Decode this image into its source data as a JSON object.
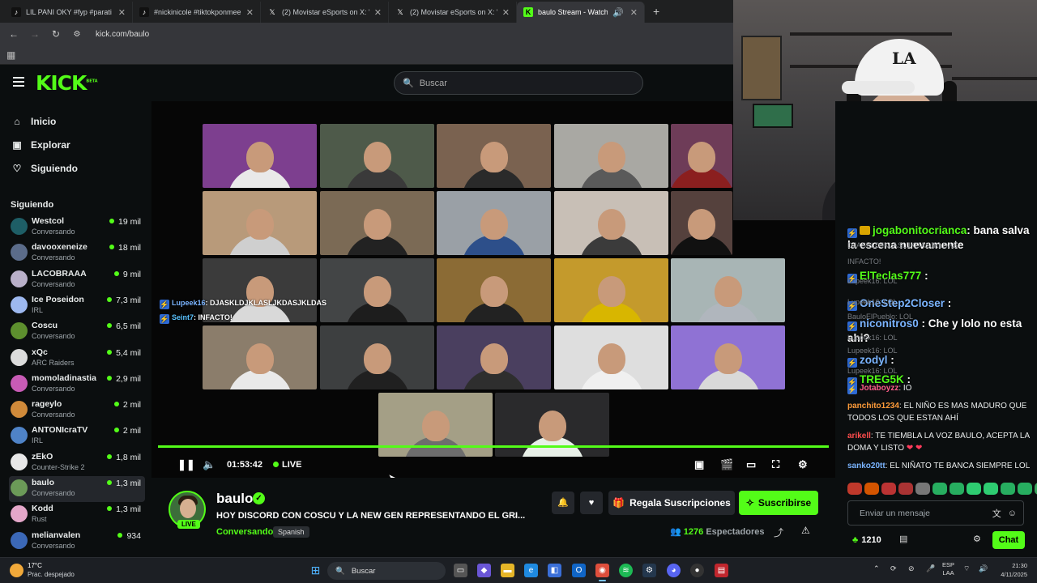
{
  "browser": {
    "tabs": [
      {
        "title": "LIL PANI OKY #fyp #parati #oky",
        "icon": "tiktok-icon",
        "active": false
      },
      {
        "title": "#nickinicole #tiktokponmee",
        "icon": "tiktok-icon",
        "active": false
      },
      {
        "title": "(2) Movistar eSports on X: \"",
        "icon": "x-icon",
        "active": false
      },
      {
        "title": "(2) Movistar eSports on X: \"",
        "icon": "x-icon",
        "active": false
      },
      {
        "title": "baulo Stream - Watch Live",
        "icon": "kick-icon",
        "active": true
      }
    ],
    "new_tab": "+",
    "url": "kick.com/baulo"
  },
  "kick": {
    "logo": "KICK",
    "logo_sup": "BETA",
    "search_placeholder": "Buscar",
    "nav": [
      {
        "label": "Inicio",
        "icon": "home-icon"
      },
      {
        "label": "Explorar",
        "icon": "compass-icon"
      },
      {
        "label": "Siguiendo",
        "icon": "heart-icon"
      }
    ],
    "following_title": "Siguiendo",
    "following": [
      {
        "name": "Westcol",
        "category": "Conversando",
        "viewers": "19 mil",
        "color": "#1e5e66"
      },
      {
        "name": "davooxeneize",
        "category": "Conversando",
        "viewers": "18 mil",
        "color": "#5b6c8a"
      },
      {
        "name": "LACOBRAAA",
        "category": "Conversando",
        "viewers": "9 mil",
        "color": "#b9b0c9"
      },
      {
        "name": "Ice Poseidon",
        "category": "IRL",
        "viewers": "7,3 mil",
        "color": "#9db8ef"
      },
      {
        "name": "Coscu",
        "category": "Conversando",
        "viewers": "6,5 mil",
        "color": "#5d8f2e"
      },
      {
        "name": "xQc",
        "category": "ARC Raiders",
        "viewers": "5,4 mil",
        "color": "#dcdcdc"
      },
      {
        "name": "momoladinastia",
        "category": "Conversando",
        "viewers": "2,9 mil",
        "color": "#c85bb5"
      },
      {
        "name": "rageylo",
        "category": "Conversando",
        "viewers": "2 mil",
        "color": "#d08a3a"
      },
      {
        "name": "ANTONIcraTV",
        "category": "IRL",
        "viewers": "2 mil",
        "color": "#4f83c7"
      },
      {
        "name": "zEkO",
        "category": "Counter-Strike 2",
        "viewers": "1,8 mil",
        "color": "#e7e7e7"
      },
      {
        "name": "baulo",
        "category": "Conversando",
        "viewers": "1,3 mil",
        "color": "#6b9a58"
      },
      {
        "name": "Kodd",
        "category": "Rust",
        "viewers": "1,3 mil",
        "color": "#e4a7c9"
      },
      {
        "name": "melianvalen",
        "category": "Conversando",
        "viewers": "934",
        "color": "#3b68b7"
      }
    ],
    "active_channel": "baulo"
  },
  "player": {
    "overlay_chat": [
      {
        "user": "Lupeek16",
        "text": ": DJASKLDJKLASLJKDASJKLDAS"
      },
      {
        "user": "Seint7",
        "text": ": INFACTO!"
      }
    ],
    "time": "01:53:42",
    "live_label": "LIVE",
    "progress": 1.0
  },
  "stream": {
    "streamer": "baulo",
    "live_badge": "LIVE",
    "title": "HOY DISCORD CON COSCU Y LA NEW GEN REPRESENTANDO EL GRI...",
    "category": "Conversando",
    "language": "Spanish",
    "gift_label": "Regala Suscripciones",
    "subscribe_label": "Suscribirse",
    "viewers": "1276",
    "viewers_label": "Espectadores"
  },
  "chat": {
    "big_messages": [
      {
        "user": "jogabonitocrianca",
        "text": ": bana salva la escena nuevamente",
        "user_color": "#53fc18"
      },
      {
        "user": "ElTeclas777",
        "text": " :",
        "user_color": "#53fc18"
      },
      {
        "user": "OneStep2Closer",
        "text": " :",
        "user_color": "#7ab4ff"
      },
      {
        "user": "niconitros0",
        "text": " : Che y lolo no esta ahi?",
        "user_color": "#7ab4ff"
      },
      {
        "user": "zodyl",
        "text": " :",
        "user_color": "#7ab4ff"
      },
      {
        "user": "TREG5K",
        "text": " :",
        "user_color": "#53fc18"
      }
    ],
    "ghost_lines": [
      "DJASKLDJKLASLJKDASJKLDAS",
      "INFACTO!",
      "Lupeek16: LOL",
      "Lupeek16: LOL",
      "BauloElPueblo: LOL",
      "Lupeek16: LOL",
      "Lupeek16: LOL",
      "Lupeek16: LOL"
    ],
    "messages": [
      {
        "user": "Jotaboyzz",
        "text": ": IO",
        "user_color": "#ff5c8a"
      },
      {
        "user": "panchito1234",
        "text": ": EL NIÑO ES MAS MADURO QUE TODOS LOS QUE ESTAN AHÍ",
        "user_color": "#ff9c3a"
      },
      {
        "user": "arikell",
        "text": ": TE TIEMBLA LA VOZ BAULO, ACEPTA LA DOMA Y LISTO",
        "user_color": "#ff4d4d"
      },
      {
        "user": "sanko20tt",
        "text": ": EL NIÑATO TE BANCA SIEMPRE LOL",
        "user_color": "#7ab4ff"
      }
    ],
    "input_placeholder": "Enviar un mensaje",
    "points": "1210",
    "chat_button": "Chat"
  },
  "taskbar": {
    "temperature": "17°C",
    "condition": "Prac. despejado",
    "search_label": "Buscar",
    "lang_top": "ESP",
    "lang_bottom": "LAA",
    "time": "21:30",
    "date": "4/11/2025"
  }
}
